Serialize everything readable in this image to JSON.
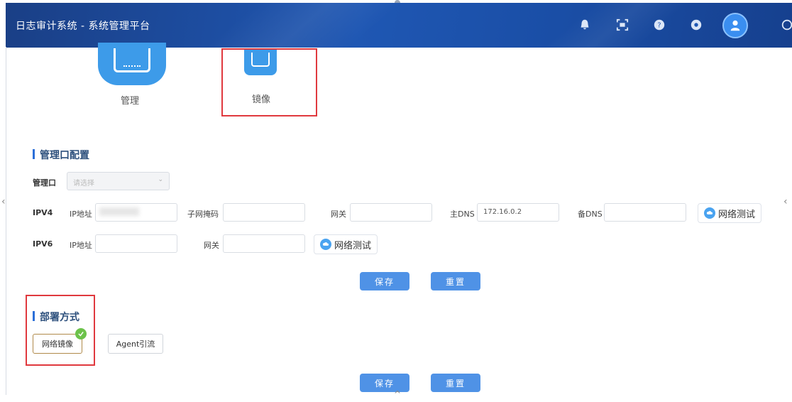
{
  "header": {
    "title": "日志审计系统 - 系统管理平台",
    "icons": [
      "bell-icon",
      "scan-icon",
      "help-icon",
      "info-icon",
      "user-avatar-icon",
      "logout-icon"
    ]
  },
  "modes": {
    "management": {
      "label": "管理",
      "icon": "network-port-icon"
    },
    "mirror": {
      "label": "镜像",
      "icon": "network-port-icon",
      "highlighted": true
    }
  },
  "mgmt_config": {
    "title": "管理口配置",
    "port_label": "管理口",
    "port_select": {
      "value": "请选择"
    },
    "ipv4": {
      "label": "IPV4",
      "ip_label": "IP地址",
      "ip_value": "",
      "mask_label": "子网掩码",
      "mask_value": "",
      "gateway_label": "网关",
      "gateway_value": "",
      "dns_primary_label": "主DNS",
      "dns_primary_value": "172.16.0.2",
      "dns_backup_label": "备DNS",
      "dns_backup_value": "",
      "test_label": "网络测试"
    },
    "ipv6": {
      "label": "IPV6",
      "ip_label": "IP地址",
      "ip_value": "",
      "gateway_label": "网关",
      "gateway_value": "",
      "test_label": "网络测试"
    },
    "save_label": "保存",
    "reset_label": "重置"
  },
  "deploy": {
    "title": "部署方式",
    "options": [
      {
        "label": "网络镜像",
        "selected": true
      },
      {
        "label": "Agent引流",
        "selected": false
      }
    ],
    "save_label": "保存",
    "reset_label": "重置"
  },
  "colors": {
    "header": "#1f57b3",
    "accent": "#4f92e6",
    "highlight": "#e0393e",
    "check": "#6cc24a"
  }
}
